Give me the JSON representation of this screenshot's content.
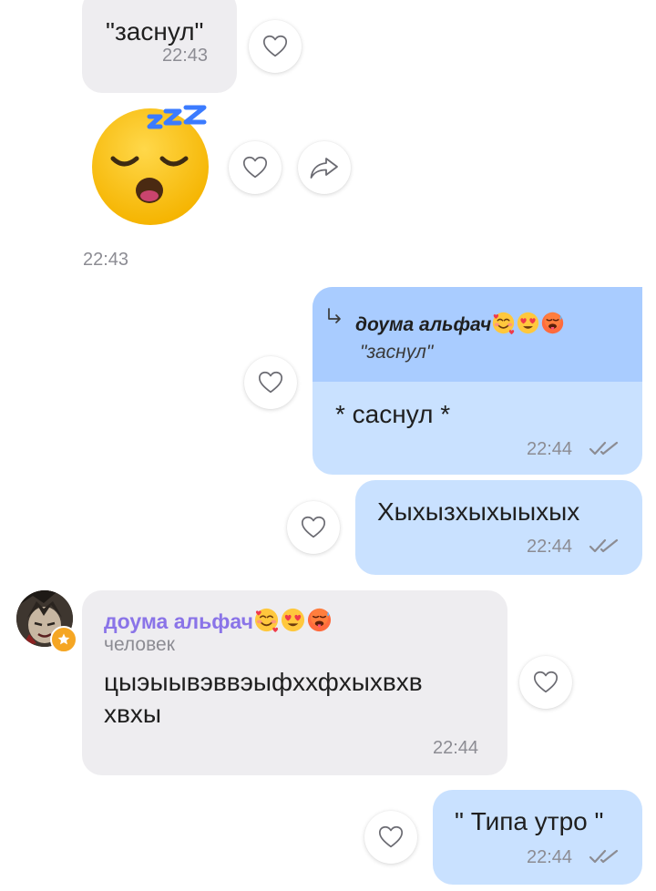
{
  "messages": {
    "m1": {
      "text": "\"заснул\"",
      "time": "22:43"
    },
    "m2": {
      "emoji": "sleeping-face",
      "time": "22:43"
    },
    "m3": {
      "quote_author": "доума альфач",
      "quote_author_emojis": [
        "smiling-face-with-hearts",
        "heart-eyes",
        "hot-face"
      ],
      "quote_text": "\"заснул\"",
      "text": "* саснул *",
      "time": "22:44"
    },
    "m4": {
      "text": "Хыхызхыхыыхых",
      "time": "22:44"
    },
    "m5": {
      "sender_name": "доума альфач",
      "sender_emojis": [
        "smiling-face-with-hearts",
        "heart-eyes",
        "hot-face"
      ],
      "sender_role": "человек",
      "text_line1": "цыэыывэввэыфххфхыхвхв",
      "text_line2": "хвхы",
      "time": "22:44"
    },
    "m6": {
      "text": "\" Типа утро \"",
      "time": "22:44"
    }
  },
  "colors": {
    "incoming_bubble": "#eeedf0",
    "outgoing_bubble": "#c9e1ff",
    "quote_block": "#a9ccff",
    "sender_name": "#8a74e8",
    "timestamp": "#8c8c93"
  },
  "icons": [
    "heart-icon",
    "share-arrow-icon",
    "reply-arrow-icon",
    "double-check-icon",
    "star-badge-icon"
  ]
}
